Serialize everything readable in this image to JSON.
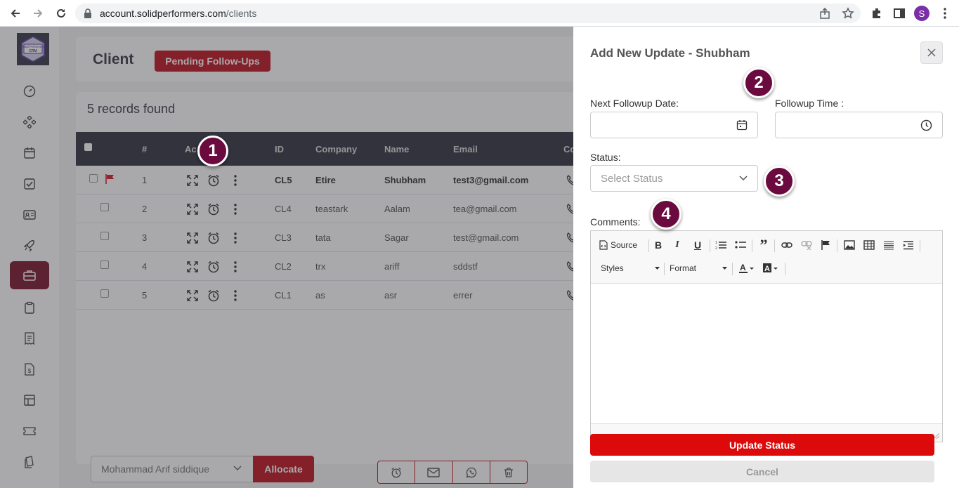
{
  "browser": {
    "url_host": "account.solidperformers.com",
    "url_path": "/clients",
    "profile_initial": "S"
  },
  "logo": {
    "line1": "Solid Performers",
    "line2": "CRM"
  },
  "header": {
    "title": "Client",
    "pending_label": "Pending Follow-Ups"
  },
  "records_found": "5 records found",
  "table": {
    "columns": [
      "#",
      "Ac",
      "ID",
      "Company",
      "Name",
      "Email",
      "Co"
    ],
    "rows": [
      {
        "num": "1",
        "id": "CL5",
        "company": "Etire",
        "name": "Shubham",
        "email": "test3@gmail.com",
        "flagged": true
      },
      {
        "num": "2",
        "id": "CL4",
        "company": "teastark",
        "name": "Aalam",
        "email": "tea@gmail.com",
        "flagged": false
      },
      {
        "num": "3",
        "id": "CL3",
        "company": "tata",
        "name": "Sagar",
        "email": "test@gmail.com",
        "flagged": false
      },
      {
        "num": "4",
        "id": "CL2",
        "company": "trx",
        "name": "ariff",
        "email": "sddstf",
        "flagged": false
      },
      {
        "num": "5",
        "id": "CL1",
        "company": "as",
        "name": "asr",
        "email": "errer",
        "flagged": false
      }
    ]
  },
  "bottom": {
    "assignee": "Mohammad Arif siddique",
    "allocate_label": "Allocate"
  },
  "panel": {
    "title": "Add New Update - Shubham",
    "next_followup_label": "Next Followup Date:",
    "followup_time_label": "Followup Time :",
    "status_label": "Status:",
    "status_placeholder": "Select Status",
    "comments_label": "Comments:",
    "source_label": "Source",
    "styles_label": "Styles",
    "format_label": "Format",
    "update_label": "Update Status",
    "cancel_label": "Cancel"
  },
  "badges": [
    "1",
    "2",
    "3",
    "4"
  ],
  "colors": {
    "brand": "#c0141f",
    "sidebar_active": "#7a1730",
    "badge": "#6a0a3e",
    "table_header": "#343443",
    "update_button": "#dc0a0a"
  }
}
